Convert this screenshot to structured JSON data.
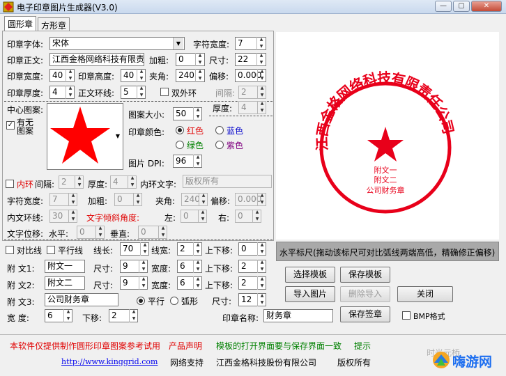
{
  "window": {
    "title": "电子印章图片生成器(V3.0)"
  },
  "tabs": [
    "圆形章",
    "方形章"
  ],
  "seal_font": {
    "label": "印章字体:",
    "value": "宋体"
  },
  "char_width": {
    "label": "字符宽度:",
    "value": "7"
  },
  "seal_text": {
    "label": "印章正文:",
    "value": "江西金格网络科技有限责"
  },
  "bold": {
    "label": "加粗:",
    "value": "0"
  },
  "size": {
    "label": "尺寸:",
    "value": "22"
  },
  "seal_width": {
    "label": "印章宽度:",
    "value": "40"
  },
  "seal_height": {
    "label": "印章高度:",
    "value": "40"
  },
  "angle": {
    "label": "夹角:",
    "value": "240"
  },
  "offset": {
    "label": "偏移:",
    "value": "0.000"
  },
  "seal_thickness": {
    "label": "印章厚度:",
    "value": "4"
  },
  "text_ring_distance": {
    "label": "正文环线:",
    "value": "5"
  },
  "double_ring": {
    "label": "双外环"
  },
  "gap": {
    "label": "间隔:",
    "value": "2"
  },
  "thickness2": {
    "label": "厚度:",
    "value": "4"
  },
  "center_image": {
    "label": "中心图案:",
    "has_label_1": "有无",
    "has_label_2": "图案",
    "checked": true
  },
  "image_size": {
    "label": "图案大小:",
    "value": "50"
  },
  "seal_color": {
    "label": "印章颜色:",
    "options": [
      "红色",
      "蓝色",
      "绿色",
      "紫色"
    ],
    "selected": "红色"
  },
  "dpi": {
    "label": "图片 DPI:",
    "value": "96"
  },
  "inner_ring": {
    "label": "内环",
    "gap_label": "间隔:",
    "gap_value": "2",
    "thickness_label": "厚度:",
    "thickness_value": "4",
    "text_label": "内环文字:",
    "text_value": "版权所有"
  },
  "inner_char_width": {
    "label": "字符宽度:",
    "value": "7"
  },
  "inner_bold": {
    "label": "加粗:",
    "value": "0"
  },
  "inner_angle": {
    "label": "夹角:",
    "value": "240"
  },
  "inner_offset": {
    "label": "偏移:",
    "value": "0.000"
  },
  "inner_text_ring": {
    "label": "内文环线:",
    "value": "30"
  },
  "text_tilt": {
    "label": "文字倾斜角度:",
    "left_label": "左:",
    "left_value": "0",
    "right_label": "右:",
    "right_value": "0"
  },
  "text_shift": {
    "label": "文字位移:",
    "h_label": "水平:",
    "h_value": "0",
    "v_label": "垂直:",
    "v_value": "0"
  },
  "line_opts": {
    "contrast_label": "对比线",
    "parallel_label": "平行线",
    "length_label": "线长:",
    "length_value": "70",
    "width_label": "线宽:",
    "width_value": "2",
    "updown_label": "上下移:",
    "updown_value": "0"
  },
  "attached1": {
    "label": "附  文1:",
    "value": "附文一",
    "size_label": "尺寸:",
    "size_value": "9",
    "width_label": "宽度:",
    "width_value": "6",
    "updown_label": "上下移:",
    "updown_value": "2"
  },
  "attached2": {
    "label": "附  文2:",
    "value": "附文二",
    "size_label": "尺寸:",
    "size_value": "9",
    "width_label": "宽度:",
    "width_value": "6",
    "updown_label": "上下移:",
    "updown_value": "2"
  },
  "attached3": {
    "label": "附  文3:",
    "value": "公司财务章",
    "parallel_label": "平行",
    "arc_label": "弧形",
    "size_label": "尺寸:",
    "size_value": "12"
  },
  "width_row": {
    "label": "宽    度:",
    "value": "6",
    "down_label": "下移:",
    "down_value": "2"
  },
  "seal_name": {
    "label": "印章名称:",
    "value": "财务章"
  },
  "ruler_hint": "水平标尺(拖动该标尺可对比弧线两端高低，精确修正偏移)",
  "buttons": {
    "select_template": "选择模板",
    "save_template": "保存模板",
    "import_image": "导入图片",
    "delete_import": "删除导入",
    "close": "关闭",
    "save_seal": "保存签章",
    "bmp_format": "BMP格式"
  },
  "seal_preview": {
    "ring_text": "江西金格网络科技有限责任公司",
    "line1": "附文一",
    "line2": "附文二",
    "line3": "公司财务章"
  },
  "footer": {
    "notice": "本软件仅提供制作圆形印章图案参考试用",
    "statement": "产品声明",
    "tip_text": "模板的打开界面要与保存界面一致",
    "tip": "提示",
    "url": "http://www.kinggrid.com",
    "support": "网络支持",
    "company": "江西金格科技股份有限公司",
    "copyright": "版权所有"
  },
  "watermark": {
    "text": "嗨游网",
    "sub": "时光元桥"
  },
  "colors": {
    "red": "#ff0000",
    "seal_red": "#e8001a",
    "green": "#008000"
  }
}
